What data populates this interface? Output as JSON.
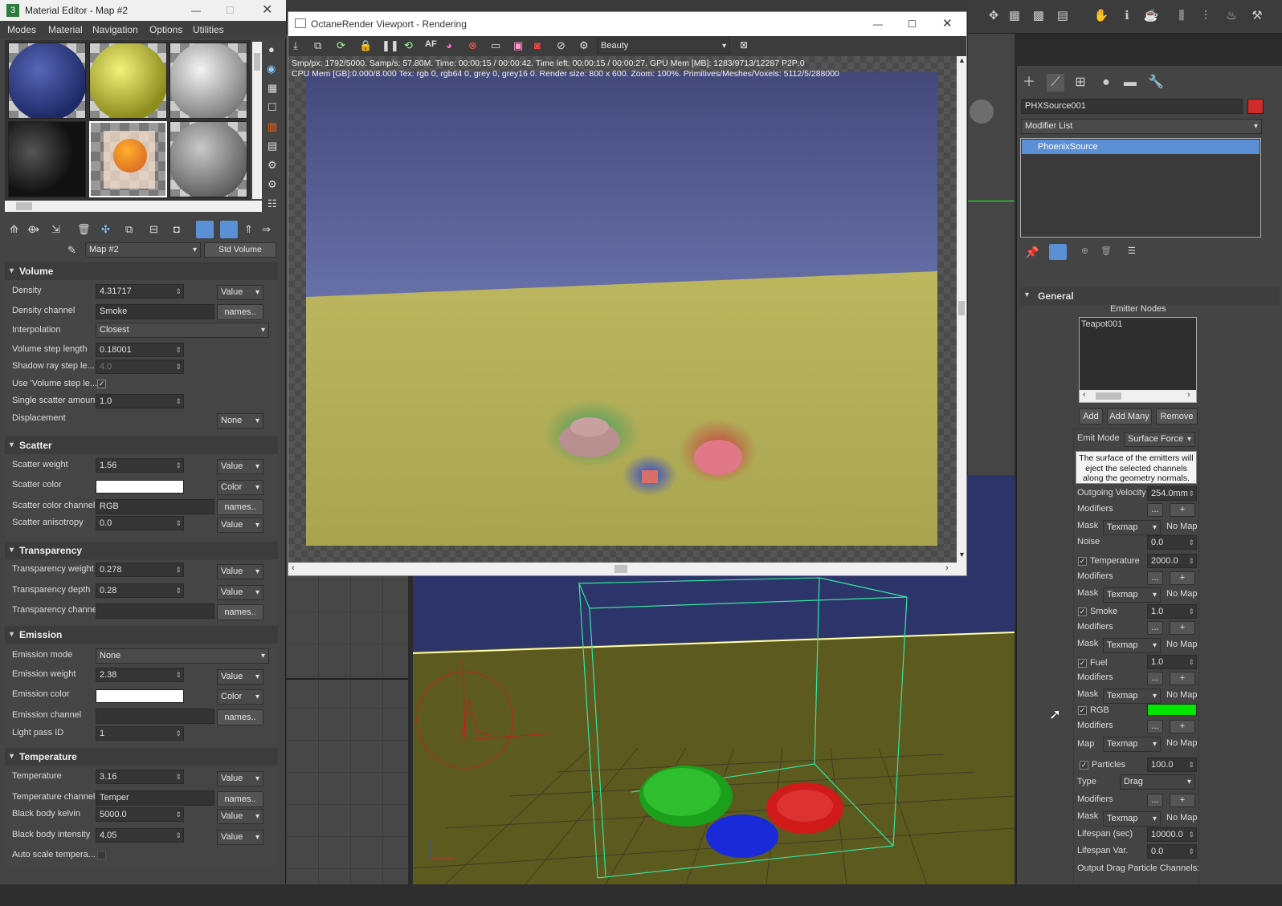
{
  "material_editor": {
    "title": "Material Editor - Map #2",
    "menu": [
      "Modes",
      "Material",
      "Navigation",
      "Options",
      "Utilities"
    ],
    "map_name": "Map #2",
    "map_type": "Std Volume mediur",
    "volume": {
      "header": "Volume",
      "density_label": "Density",
      "density": "4.31717",
      "density_mode": "Value",
      "density_channel_label": "Density channel",
      "density_channel": "Smoke",
      "names_btn": "names..",
      "interpolation_label": "Interpolation",
      "interpolation": "Closest",
      "step_label": "Volume step length",
      "step": "0.18001",
      "shadow_label": "Shadow ray step le...",
      "shadow": "4.0",
      "use_step_label": "Use 'Volume step le...",
      "single_scatter_label": "Single scatter amount",
      "single_scatter": "1.0",
      "displacement_label": "Displacement",
      "displacement": "None"
    },
    "scatter": {
      "header": "Scatter",
      "weight_label": "Scatter weight",
      "weight": "1.56",
      "weight_mode": "Value",
      "color_label": "Scatter color",
      "color_mode": "Color",
      "channel_label": "Scatter color channel",
      "channel": "RGB",
      "names_btn": "names..",
      "aniso_label": "Scatter anisotropy",
      "aniso": "0.0",
      "aniso_mode": "Value"
    },
    "transparency": {
      "header": "Transparency",
      "weight_label": "Transparency weight",
      "weight": "0.278",
      "weight_mode": "Value",
      "depth_label": "Transparency depth",
      "depth": "0.28",
      "depth_mode": "Value",
      "channel_label": "Transparency channel",
      "names_btn": "names.."
    },
    "emission": {
      "header": "Emission",
      "mode_label": "Emission mode",
      "mode": "None",
      "weight_label": "Emission weight",
      "weight": "2.38",
      "weight_mode": "Value",
      "color_label": "Emission color",
      "color_mode": "Color",
      "channel_label": "Emission channel",
      "names_btn": "names..",
      "lightpass_label": "Light pass ID",
      "lightpass": "1"
    },
    "temperature": {
      "header": "Temperature",
      "temp_label": "Temperature",
      "temp": "3.16",
      "temp_mode": "Value",
      "channel_label": "Temperature channel",
      "channel": "Temper",
      "names_btn": "names..",
      "kelvin_label": "Black body kelvin",
      "kelvin": "5000.0",
      "kelvin_mode": "Value",
      "intensity_label": "Black body intensity",
      "intensity": "4.05",
      "intensity_mode": "Value",
      "autoscale_label": "Auto scale tempera..."
    }
  },
  "octane": {
    "title": "OctaneRender Viewport - Rendering",
    "pass": "Beauty",
    "stats_line1": "Smp/px: 1792/5000.   Samp/s: 57.80M.   Time: 00:00:15 / 00:00:42.   Time left: 00:00:15 / 00:00:27.   GPU Mem [MB]: 1283/9713/12287 P2P:0",
    "stats_line2": "CPU Mem [GB]:0.000/8.000   Tex: rgb 0, rgb64 0, grey 0, grey16 0.   Render size: 800 x 600.   Zoom: 100%.   Primitives/Meshes/Voxels: 5112/5/288000",
    "button_icons": [
      "save-icon",
      "copy-icon",
      "refresh-icon",
      "lock-icon",
      "pause-icon",
      "restart-icon",
      "af-icon",
      "color-icon",
      "stop-icon",
      "region-icon",
      "film-icon",
      "camera-icon",
      "film-off-icon",
      "settings-icon"
    ]
  },
  "command_panel": {
    "object_name": "PHXSource001",
    "object_color": "#d02a2a",
    "modifier_list": "Modifier List",
    "stack_item": "PhoenixSource",
    "general_header": "General",
    "emitter_nodes_label": "Emitter Nodes",
    "emitter_nodes": [
      "Teapot001"
    ],
    "add_btn": "Add",
    "add_many_btn": "Add Many",
    "remove_btn": "Remove",
    "emit_mode_label": "Emit Mode",
    "emit_mode": "Surface Force",
    "emit_description": "The surface of the emitters will eject the selected channels along the geometry normals.",
    "outgoing_velocity_label": "Outgoing Velocity",
    "outgoing_velocity": "254.0mm",
    "modifiers_label": "Modifiers",
    "dots_btn": "...",
    "plus_btn": "+",
    "mask_label": "Mask",
    "texmap": "Texmap",
    "no_map": "No Map",
    "noise_label": "Noise",
    "noise": "0.0",
    "temperature_label": "Temperature",
    "temperature": "2000.0",
    "smoke_label": "Smoke",
    "smoke": "1.0",
    "fuel_label": "Fuel",
    "fuel": "1.0",
    "rgb_label": "RGB",
    "rgb_color": "#00e600",
    "map_label": "Map",
    "particles_label": "Particles",
    "particles": "100.0",
    "type_label": "Type",
    "type": "Drag",
    "lifespan_label": "Lifespan (sec)",
    "lifespan": "10000.0",
    "lifespan_var_label": "Lifespan Var.",
    "lifespan_var": "0.0",
    "output_label": "Output Drag Particle Channels:"
  }
}
